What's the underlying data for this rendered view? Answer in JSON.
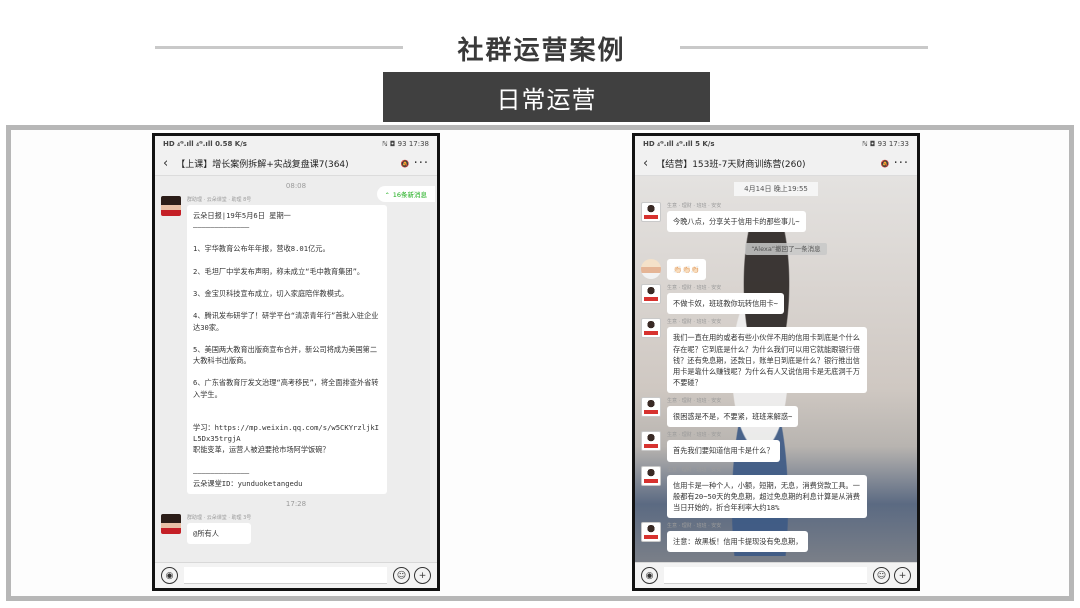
{
  "slide": {
    "title": "社群运营案例",
    "subtitle": "日常运营"
  },
  "left_phone": {
    "status_left": "HD ₄ᴳ.ıll ₄ᴳ.ıll 0.58 K/s",
    "status_right": "ℕ ◘ 93 17:38",
    "chat_title": "【上课】增长案例拆解+实战复盘课7(364)",
    "mute_icon": "🔕",
    "new_messages": "16条新消息",
    "time1": "08:08",
    "sender1": "群助理 · 云朵课堂 · 助理 8号",
    "message1": "云朵日报|19年5月6日 星期一\n—————————————\n\n1、宇华教育公布年年报，营收8.01亿元。\n\n2、毛坦厂中学发布声明，称未成立“毛中教育集团”。\n\n3、金宝贝科技宣布成立，切入家庭陪伴教模式。\n\n4、腾讯发布研学了！研学平台“清凉青年行”首批入驻企业达30家。\n\n5、美国两大教育出版商宣布合并，新公司将成为美国第二大教科书出版商。\n\n6、广东省教育厅发文治理“高考移民”，将全面排查外省转入学生。\n\n\n学习：https://mp.weixin.qq.com/s/w5CKYrzljkIL5Dx35trgjA\n职能变革，运营人被迫要抢市场阿学饭碗？\n\n—————————————\n云朵课堂ID：yunduoketangedu",
    "time2": "17:28",
    "sender2": "群助理 · 云朵课堂 · 助理 3号",
    "message2": "@所有人"
  },
  "right_phone": {
    "status_left": "HD ₄ᴳ.ıll ₄ᴳ.ıll 5 K/s",
    "status_right": "ℕ ◘ 93 17:33",
    "chat_title": "【结营】153班-7天财商训练营(260)",
    "mute_icon": "🔕",
    "time1": "4月14日 晚上19:55",
    "sender_a": "生意 · 理财 · 班班 · 安安",
    "message1": "今晚八点，分享关于信用卡的那些事儿~",
    "notice": "“Alexa”撤回了一条消息",
    "message2": "👏🏻👏🏻👏🏻",
    "message3": "不做卡奴，班班教你玩转信用卡~",
    "message4": "我们一直在用的或者有些小伙伴不用的信用卡到底是个什么存在呢？它到底是什么？为什么我们可以用它就能跟银行借钱？还有免息期，还款日，账单日到底是什么？银行推出信用卡是靠什么赚钱呢？为什么有人又说信用卡是无底洞千万不要碰？",
    "message5": "很困惑是不是，不要紧，班班来解惑~",
    "message6": "首先我们要知道信用卡是什么？",
    "message7": "信用卡是一种个人，小额，短期，无息，消费贷款工具。一般都有20~50天的免息期，超过免息期的利息计算是从消费当日开始的，折合年利率大约18%",
    "message8": "注意：故黑板！信用卡提现没有免息期，"
  }
}
